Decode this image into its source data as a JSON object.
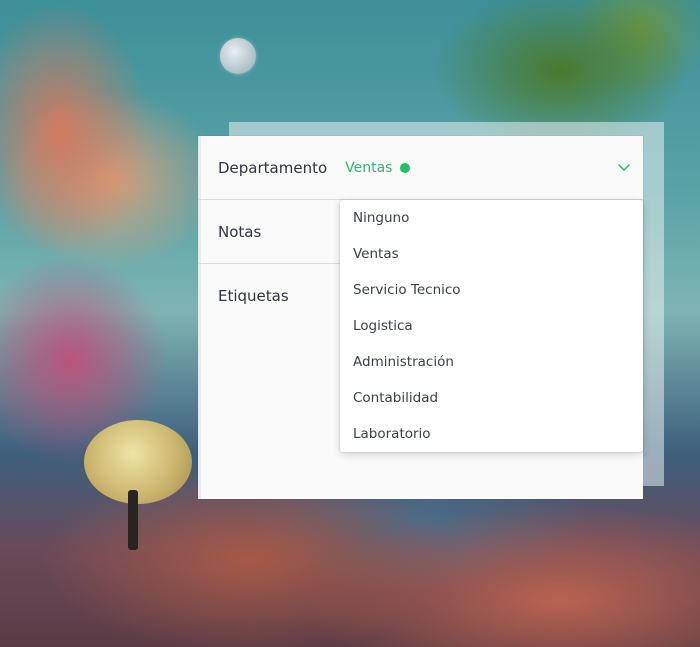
{
  "form": {
    "departamento_label": "Departamento",
    "departamento_value": "Ventas",
    "departamento_dot_color": "#1fbf6c",
    "notas_label": "Notas",
    "etiquetas_label": "Etiquetas"
  },
  "dropdown": {
    "options": [
      "Ninguno",
      "Ventas",
      "Servicio Tecnico",
      "Logistica",
      "Administración",
      "Contabilidad",
      "Laboratorio"
    ]
  },
  "colors": {
    "accent": "#2bb673"
  }
}
